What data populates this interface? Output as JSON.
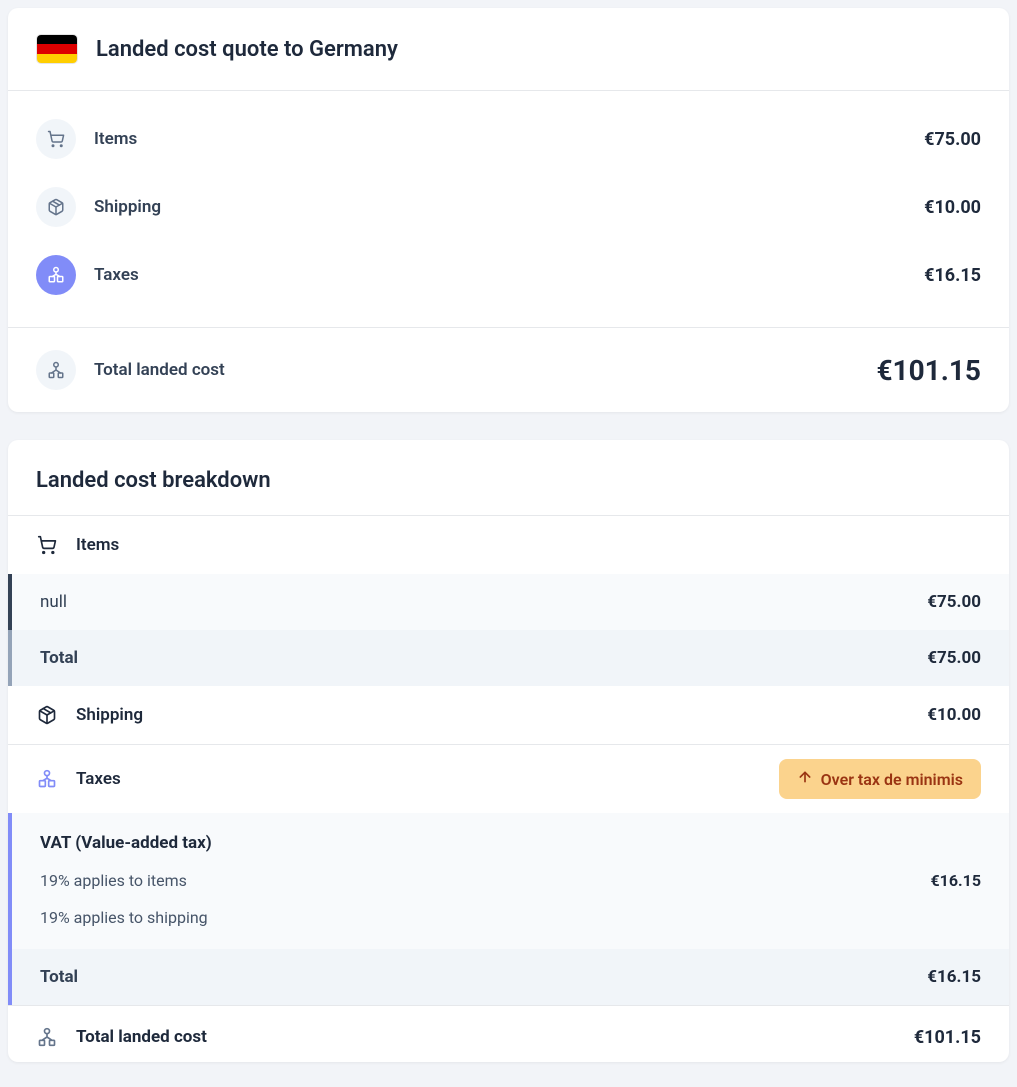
{
  "summary": {
    "title": "Landed cost quote to Germany",
    "country_flag": "germany",
    "rows": {
      "items": {
        "label": "Items",
        "value": "€75.00"
      },
      "shipping": {
        "label": "Shipping",
        "value": "€10.00"
      },
      "taxes": {
        "label": "Taxes",
        "value": "€16.15"
      }
    },
    "total": {
      "label": "Total landed cost",
      "value": "€101.15"
    }
  },
  "breakdown": {
    "title": "Landed cost breakdown",
    "items_section": {
      "label": "Items",
      "lines": [
        {
          "label": "null",
          "value": "€75.00"
        }
      ],
      "total_label": "Total",
      "total_value": "€75.00"
    },
    "shipping_section": {
      "label": "Shipping",
      "value": "€10.00"
    },
    "taxes_section": {
      "label": "Taxes",
      "badge": "Over tax de minimis",
      "vat": {
        "title": "VAT (Value-added tax)",
        "lines": [
          {
            "label": "19% applies to items",
            "value": "€16.15"
          },
          {
            "label": "19% applies to shipping",
            "value": ""
          }
        ]
      },
      "total_label": "Total",
      "total_value": "€16.15"
    },
    "final": {
      "label": "Total landed cost",
      "value": "€101.15"
    }
  }
}
